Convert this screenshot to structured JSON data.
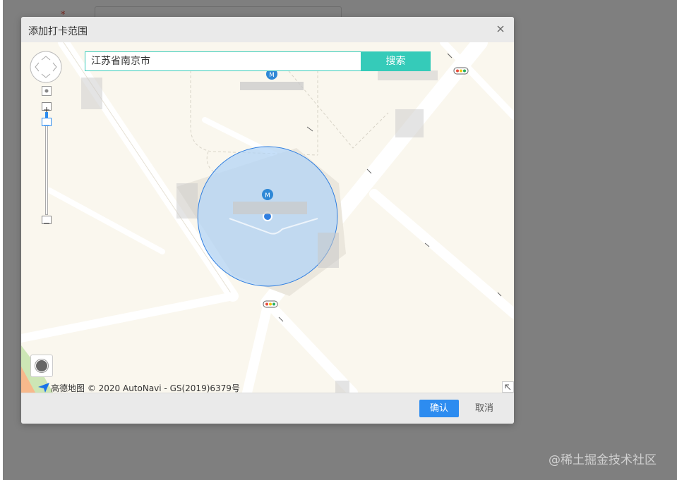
{
  "dialog": {
    "title": "添加打卡范围",
    "close_icon": "close-icon"
  },
  "search": {
    "value": "江苏省南京市",
    "button_label": "搜索"
  },
  "map": {
    "copyright": "高德地图 © 2020 AutoNavi - GS(2019)6379号",
    "controls": [
      "pan-control-icon",
      "zoom-in-icon",
      "zoom-out-icon",
      "locate-icon",
      "expand-corner-icon"
    ],
    "circle_fill": "#b3d4f5",
    "circle_stroke": "#2f7ee0"
  },
  "footer": {
    "confirm_label": "确认",
    "cancel_label": "取消",
    "confirm_color": "#2d8cf0"
  },
  "watermark": "@稀土掘金技术社区"
}
